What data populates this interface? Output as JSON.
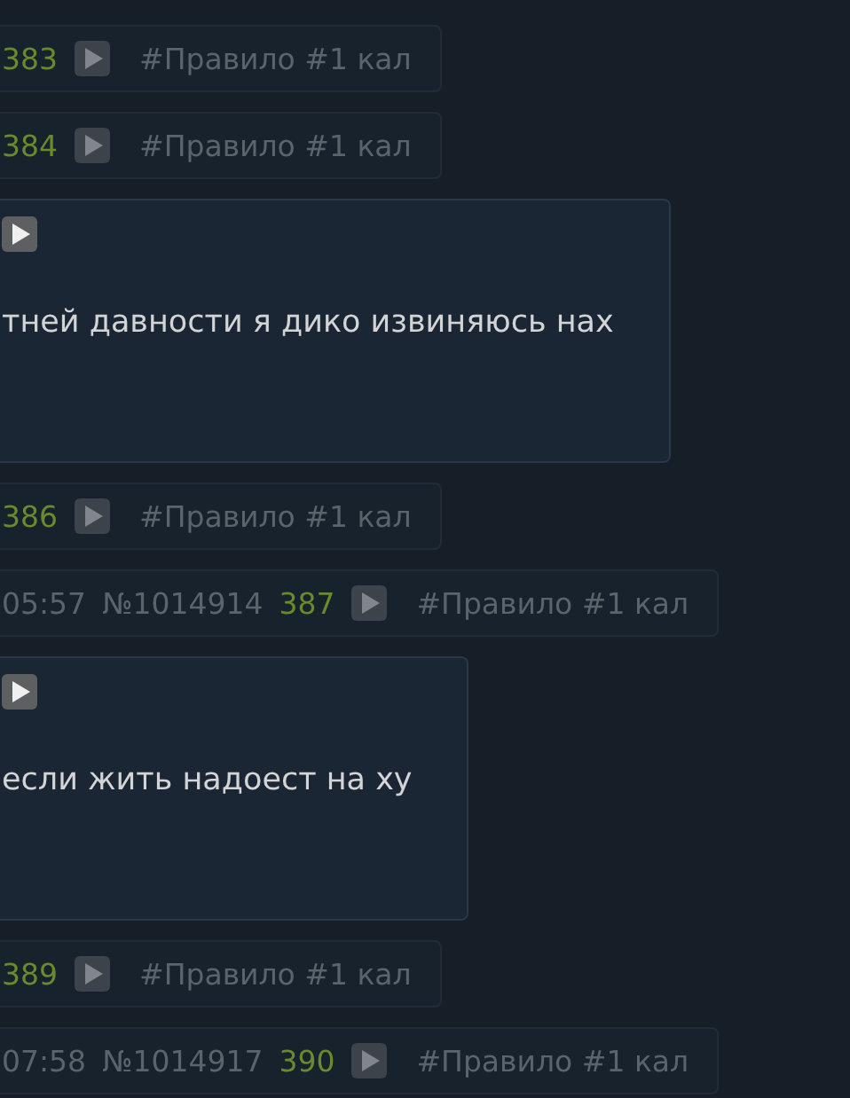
{
  "posts": [
    {
      "kind": "hidden",
      "count": "383",
      "reason": "#Правило #1 кал"
    },
    {
      "kind": "hidden",
      "count": "384",
      "reason": "#Правило #1 кал"
    },
    {
      "kind": "shown",
      "text": "тней давности я дико извиняюсь нах"
    },
    {
      "kind": "hidden",
      "count": "386",
      "reason": "#Правило #1 кал"
    },
    {
      "kind": "hidden",
      "time": "05:57",
      "number": "№1014914",
      "count": "387",
      "reason": "#Правило #1 кал"
    },
    {
      "kind": "shown",
      "text": "если жить надоест на ху"
    },
    {
      "kind": "hidden",
      "count": "389",
      "reason": "#Правило #1 кал"
    },
    {
      "kind": "hidden",
      "time": "07:58",
      "number": "№1014917",
      "count": "390",
      "reason": "#Правило #1 кал"
    }
  ]
}
